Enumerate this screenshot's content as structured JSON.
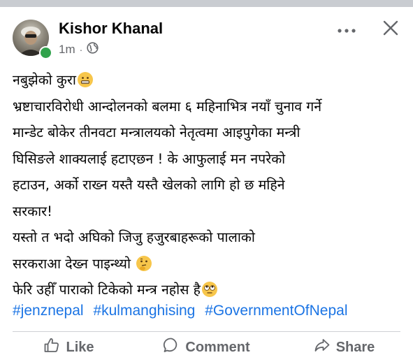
{
  "post": {
    "author": "Kishor Khanal",
    "time": "1m",
    "separator": "·",
    "privacy_icon": "globe-icon",
    "body_lines": [
      "नबुझेकाे कुरा",
      "भ्रष्टाचारविरोधी आन्दोलनको बलमा ६ महिनाभित्र नयाँ चुनाव गर्ने",
      "मान्डेट बोकेर तीनवटा मन्त्रालयको नेतृत्वमा आइपुगेका मन्त्री",
      "घिसिङले शाक्यलाई हटाएछन ! के आफुलाई मन नपरेकाे",
      "हटाउन, अर्काे राख्न यस्तै यस्तै खेलकाे लागि हाे छ महिने",
      "सरकार!",
      "यस्ताे त भदाे अघिकाे जिजु हजुरबाहरूकाे पालाकाे",
      "सरकराआ देख्न पाइन्थ्याे",
      "फेरि उहीँ पाराकाे टिकेकाे मन्त्र नहाेस है"
    ],
    "emojis": [
      "grimacing-face-emoji",
      "thinking-face-emoji",
      "rolling-eyes-face-emoji"
    ],
    "hashtags": [
      "#jenznepal",
      "#kulmanghising",
      "#GovernmentOfNepal"
    ]
  },
  "header_icons": {
    "more": "more-options-icon",
    "close": "close-icon"
  },
  "actions": {
    "like_label": "Like",
    "comment_label": "Comment",
    "share_label": "Share"
  },
  "colors": {
    "online": "#31a24c",
    "hashtag": "#1b74e4",
    "secondary_text": "#65676b",
    "divider": "#ced0d4"
  }
}
